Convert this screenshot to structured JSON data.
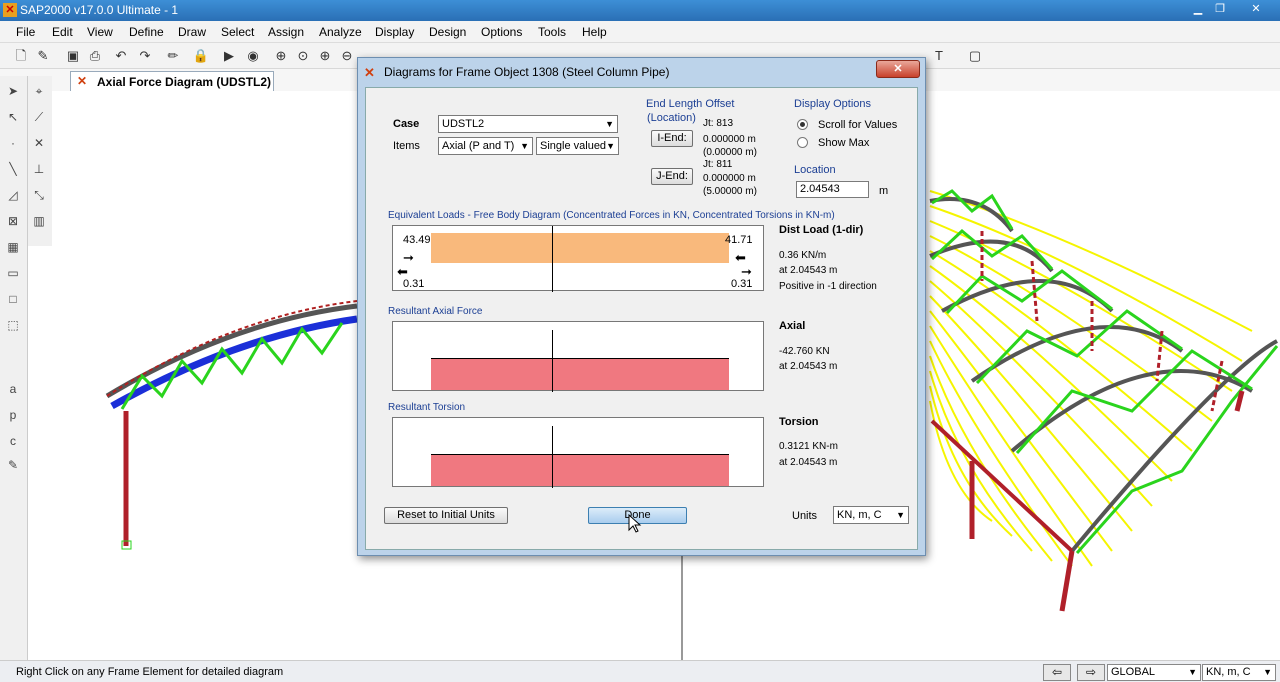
{
  "app": {
    "title": "SAP2000 v17.0.0 Ultimate  - 1"
  },
  "menu": [
    "File",
    "Edit",
    "View",
    "Define",
    "Draw",
    "Select",
    "Assign",
    "Analyze",
    "Display",
    "Design",
    "Options",
    "Tools",
    "Help"
  ],
  "tab": {
    "label": "Axial Force Diagram (UDSTL2)"
  },
  "status": {
    "text": "Right Click on any Frame Element for detailed diagram",
    "coord_system": "GLOBAL",
    "units": "KN, m, C"
  },
  "dialog": {
    "title": "Diagrams for Frame Object 1308  (Steel Column Pipe)",
    "case_label": "Case",
    "case_value": "UDSTL2",
    "items_label": "Items",
    "items_value": "Axial (P and T)",
    "items_mode": "Single valued",
    "end_offset": {
      "title_line1": "End Length Offset",
      "title_line2": "(Location)",
      "i_end_button": "I-End:",
      "i_jt": "Jt:  813",
      "i_val1": "0.000000 m",
      "i_val2": "(0.00000 m)",
      "j_end_button": "J-End:",
      "j_jt": "Jt:  811",
      "j_val1": "0.000000 m",
      "j_val2": "(5.00000 m)"
    },
    "display_options": {
      "title": "Display Options",
      "option1": "Scroll for Values",
      "option2": "Show Max",
      "selected": "Scroll for Values"
    },
    "location_label": "Location",
    "location_value": "2.04543",
    "location_unit": "m",
    "equiv": {
      "title": "Equivalent Loads - Free Body Diagram  (Concentrated Forces in KN, Concentrated Torsions in KN-m)",
      "left_top": "43.49",
      "right_top": "41.71",
      "left_bottom": "0.31",
      "right_bottom": "0.31",
      "info_title": "Dist Load (1-dir)",
      "info1": "0.36 KN/m",
      "info2": "at 2.04543 m",
      "info3": "Positive in -1 direction",
      "color": "#f9b97c"
    },
    "axial": {
      "title": "Resultant Axial Force",
      "info_title": "Axial",
      "info1": "-42.760 KN",
      "info2": "at 2.04543 m",
      "color": "#f07880"
    },
    "torsion": {
      "title": "Resultant Torsion",
      "info_title": "Torsion",
      "info1": "0.3121 KN-m",
      "info2": "at 2.04543 m",
      "color": "#f07880"
    },
    "reset_button": "Reset to Initial Units",
    "done_button": "Done",
    "units_label": "Units",
    "units_value": "KN, m, C"
  }
}
